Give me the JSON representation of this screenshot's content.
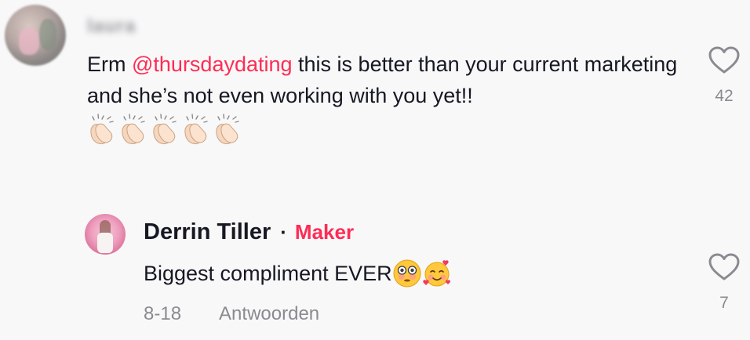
{
  "comment": {
    "username": "laura",
    "text_before": "Erm ",
    "mention": "@thursdaydating",
    "text_after": " this is better than your current marketing and she’s not even working with you yet!!",
    "emojis": [
      "clapping-hands-icon",
      "clapping-hands-icon",
      "clapping-hands-icon",
      "clapping-hands-icon",
      "clapping-hands-icon"
    ],
    "like_count": "42"
  },
  "reply": {
    "author": "Derrin Tiller",
    "separator": "·",
    "badge": "Maker",
    "text": "Biggest compliment EVER",
    "emojis": [
      "flushed-face-icon",
      "smiling-face-with-hearts-icon"
    ],
    "date": "8-18",
    "reply_action": "Antwoorden",
    "like_count": "7"
  },
  "colors": {
    "accent": "#fe2c55",
    "text": "#161823",
    "muted": "#8a8b91",
    "background": "#f8f8f8"
  }
}
